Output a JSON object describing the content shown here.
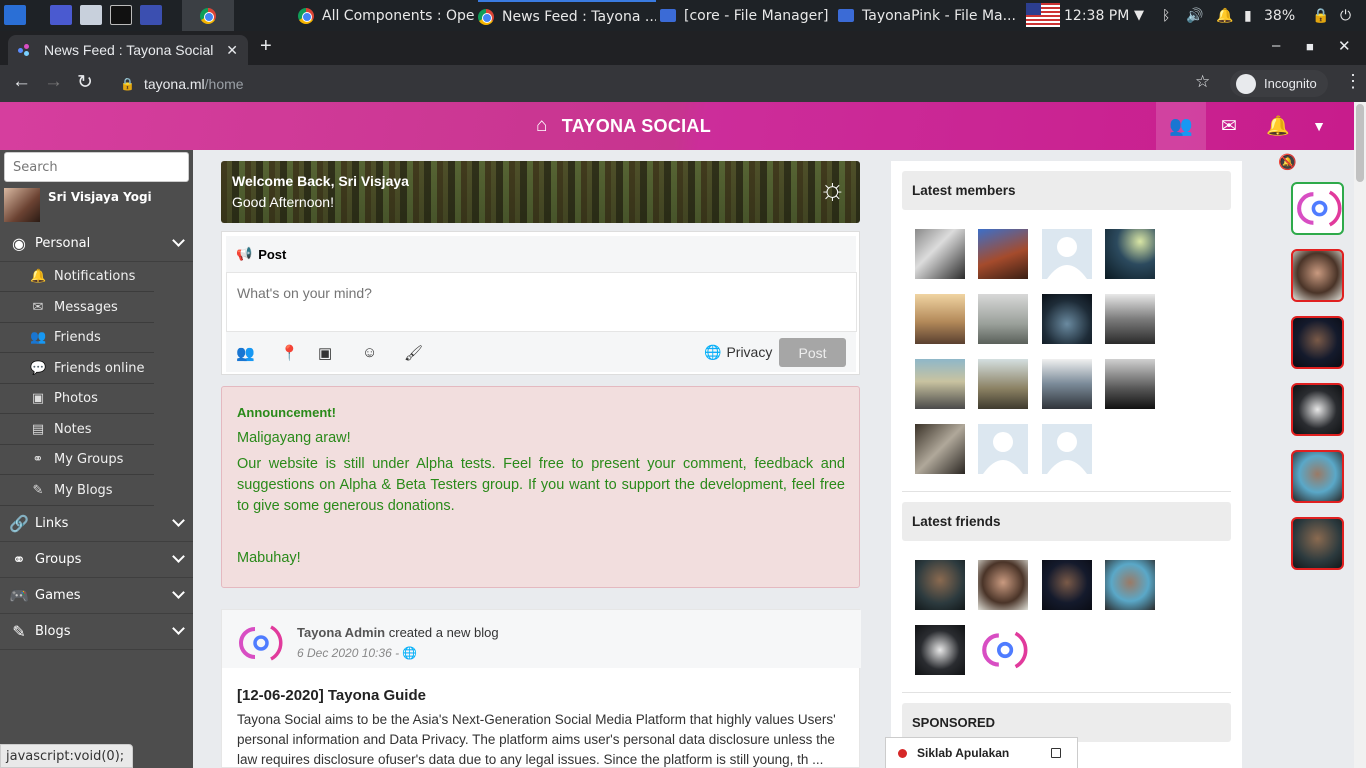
{
  "taskbar": {
    "tasks": [
      {
        "label": "All Components : Ope...",
        "icon": "chrome-icon"
      },
      {
        "label": "News Feed : Tayona ...",
        "icon": "chrome-icon"
      },
      {
        "label": "[core - File Manager]",
        "icon": "folder-icon"
      },
      {
        "label": "TayonaPink - File Ma...",
        "icon": "folder-icon"
      }
    ],
    "clock": "12:38 PM",
    "battery": "38%"
  },
  "browser": {
    "tab_title": "News Feed : Tayona Social",
    "url_domain": "tayona.ml",
    "url_path": "/home",
    "incognito_label": "Incognito"
  },
  "header": {
    "brand": "TAYONA SOCIAL",
    "icons": [
      "friends-icon",
      "mail-icon",
      "bell-icon",
      "caret-down-icon"
    ],
    "brand_color": "#c8318f"
  },
  "sidebar": {
    "search_placeholder": "Search",
    "user_name": "Sri Visjaya Yogi",
    "sections": [
      {
        "label": "Personal",
        "icon": "user-circle-icon"
      },
      {
        "label": "Links",
        "icon": "link-icon"
      },
      {
        "label": "Groups",
        "icon": "groups-icon"
      },
      {
        "label": "Games",
        "icon": "gamepad-icon"
      },
      {
        "label": "Blogs",
        "icon": "edit-icon"
      }
    ],
    "personal_items": [
      {
        "label": "Notifications",
        "icon": "bell-icon"
      },
      {
        "label": "Messages",
        "icon": "mail-icon"
      },
      {
        "label": "Friends",
        "icon": "friends-icon"
      },
      {
        "label": "Friends online",
        "icon": "chat-icon"
      },
      {
        "label": "Photos",
        "icon": "image-icon"
      },
      {
        "label": "Notes",
        "icon": "note-icon"
      },
      {
        "label": "My Groups",
        "icon": "groups-icon"
      },
      {
        "label": "My Blogs",
        "icon": "edit-icon"
      }
    ],
    "status_text": "javascript:void(0);"
  },
  "welcome": {
    "title": "Welcome Back, Sri Visjaya",
    "subtitle": "Good Afternoon!"
  },
  "composer": {
    "header": "Post",
    "placeholder": "What's on your mind?",
    "privacy_label": "Privacy",
    "post_button": "Post"
  },
  "announcement": {
    "heading": "Announcement!",
    "line1": "Maligayang araw!",
    "body": "Our website is still under Alpha tests. Feel free to present your comment, feedback and suggestions on Alpha & Beta Testers group. If you want to support the development, feel free to give some generous donations.",
    "closing": "Mabuhay!"
  },
  "feed_post": {
    "author": "Tayona Admin",
    "action": "created a new blog",
    "timestamp": "6 Dec 2020 10:36 -",
    "title": "[12-06-2020] Tayona Guide",
    "excerpt": "Tayona Social aims to be the Asia's Next-Generation Social Media Platform that highly values Users' personal information and Data Privacy. The platform aims user's personal data disclosure unless the law requires disclosure ofuser's data due to any legal issues. Since the platform is still young, th ..."
  },
  "right": {
    "latest_members_title": "Latest members",
    "latest_friends_title": "Latest friends",
    "sponsored_title": "SPONSORED"
  },
  "chat": {
    "name": "Siklab Apulakan"
  }
}
